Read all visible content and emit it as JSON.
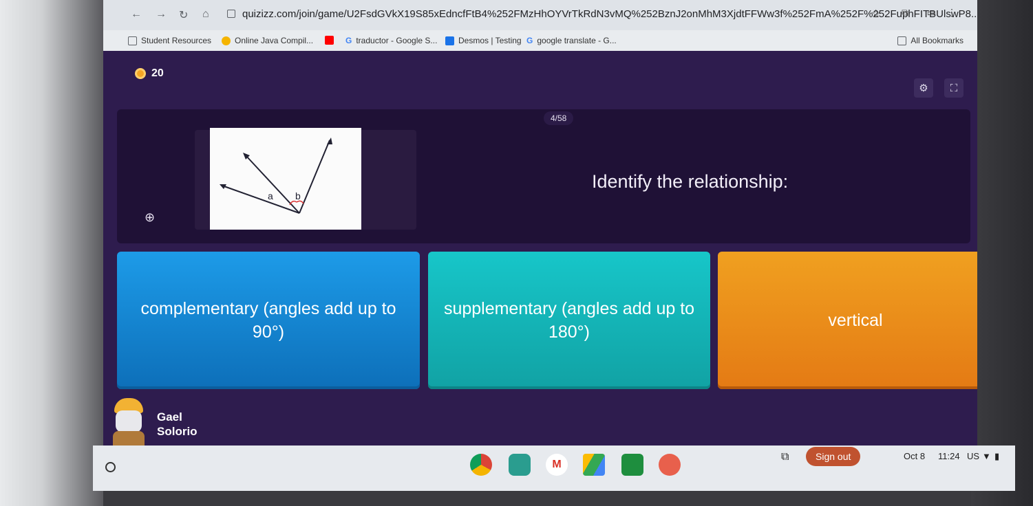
{
  "browser": {
    "url": "quizizz.com/join/game/U2FsdGVkX19S85xEdncfFtB4%252FMzHhOYVrTkRdN3vMQ%252BznJ2onMhM3XjdtFFWw3f%252FmA%252F%252FuphFITBUlswP8...",
    "bookmarks": [
      {
        "label": "Student Resources",
        "color": "#5f6368"
      },
      {
        "label": "Online Java Compil...",
        "color": "#f5b400"
      },
      {
        "label": "",
        "color": "#ff0000"
      },
      {
        "label": "traductor - Google S...",
        "color": "#4285f4"
      },
      {
        "label": "Desmos | Testing",
        "color": "#1a73e8"
      },
      {
        "label": "google translate - G...",
        "color": "#4285f4"
      }
    ],
    "all_bookmarks": "All Bookmarks"
  },
  "quiz": {
    "score": "20",
    "counter": "4/58",
    "prompt": "Identify the relationship:",
    "figure_labels": {
      "a": "a",
      "b": "b"
    },
    "options": [
      {
        "label": "complementary (angles add up to 90°)",
        "color": "#1a8fd9"
      },
      {
        "label": "supplementary (angles add up to 180°)",
        "color": "#15b8ba"
      },
      {
        "label": "vertical",
        "color": "#ec8c1a"
      }
    ],
    "player": {
      "first": "Gael",
      "last": "Solorio"
    }
  },
  "shelf": {
    "sign_out": "Sign out",
    "date": "Oct 8",
    "time": "11:24",
    "locale": "US",
    "apps": [
      "chrome",
      "classroom-meet",
      "gmail",
      "drive",
      "google-classroom",
      "paint"
    ]
  }
}
